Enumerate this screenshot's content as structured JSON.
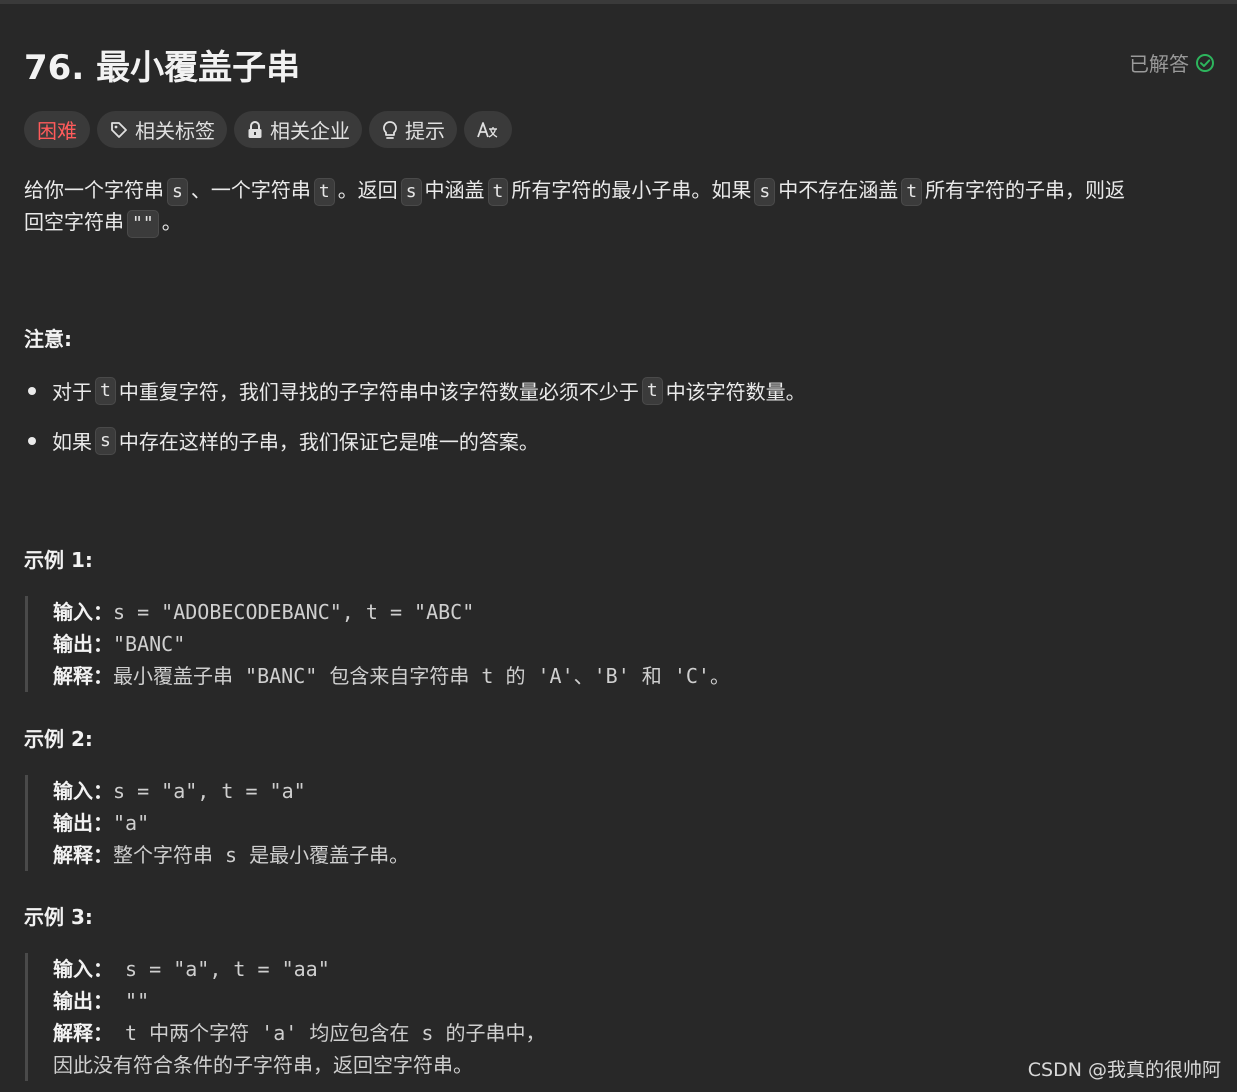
{
  "problem": {
    "title": "76. 最小覆盖子串",
    "status": "已解答"
  },
  "tags": {
    "difficulty": "困难",
    "topics": "相关标签",
    "companies": "相关企业",
    "hint": "提示",
    "translate_icon": "translate-icon"
  },
  "description": {
    "p1": "给你一个字符串",
    "code_s": "s",
    "p2": "、一个字符串",
    "code_t": "t",
    "p3": "。返回",
    "p4": "中涵盖",
    "p5": "所有字符的最小子串。如果",
    "p6": "中不存在涵盖",
    "p7": "所有字符的子串，则返",
    "p8": "回空字符串",
    "code_empty": "\"\"",
    "p9": "。"
  },
  "notes": {
    "heading": "注意:",
    "b1_pre": "对于",
    "b1_mid": "中重复字符，我们寻找的子字符串中该字符数量必须不少于",
    "b1_post": "中该字符数量。",
    "b2_pre": "如果",
    "b2_post": "中存在这样的子串，我们保证它是唯一的答案。",
    "code_t": "t",
    "code_s": "s"
  },
  "examples": [
    {
      "heading": "示例 1:",
      "input_label": "输入：",
      "input": "s = \"ADOBECODEBANC\", t = \"ABC\"",
      "output_label": "输出：",
      "output": "\"BANC\"",
      "explain_label": "解释：",
      "explain": "最小覆盖子串 \"BANC\" 包含来自字符串 t 的 'A'、'B' 和 'C'。"
    },
    {
      "heading": "示例 2:",
      "input_label": "输入：",
      "input": "s = \"a\", t = \"a\"",
      "output_label": "输出：",
      "output": "\"a\"",
      "explain_label": "解释：",
      "explain": "整个字符串 s 是最小覆盖子串。"
    },
    {
      "heading": "示例 3:",
      "input_label": "输入：",
      "input": " s = \"a\", t = \"aa\"",
      "output_label": "输出：",
      "output": " \"\"",
      "explain_label": "解释：",
      "explain": " t 中两个字符 'a' 均应包含在 s 的子串中，",
      "explain_cont": "因此没有符合条件的子字符串，返回空字符串。"
    }
  ],
  "watermark": "CSDN @我真的很帅阿",
  "colors": {
    "background": "#282828",
    "hard": "#ff5b5b",
    "solved_check": "#2db55d"
  }
}
